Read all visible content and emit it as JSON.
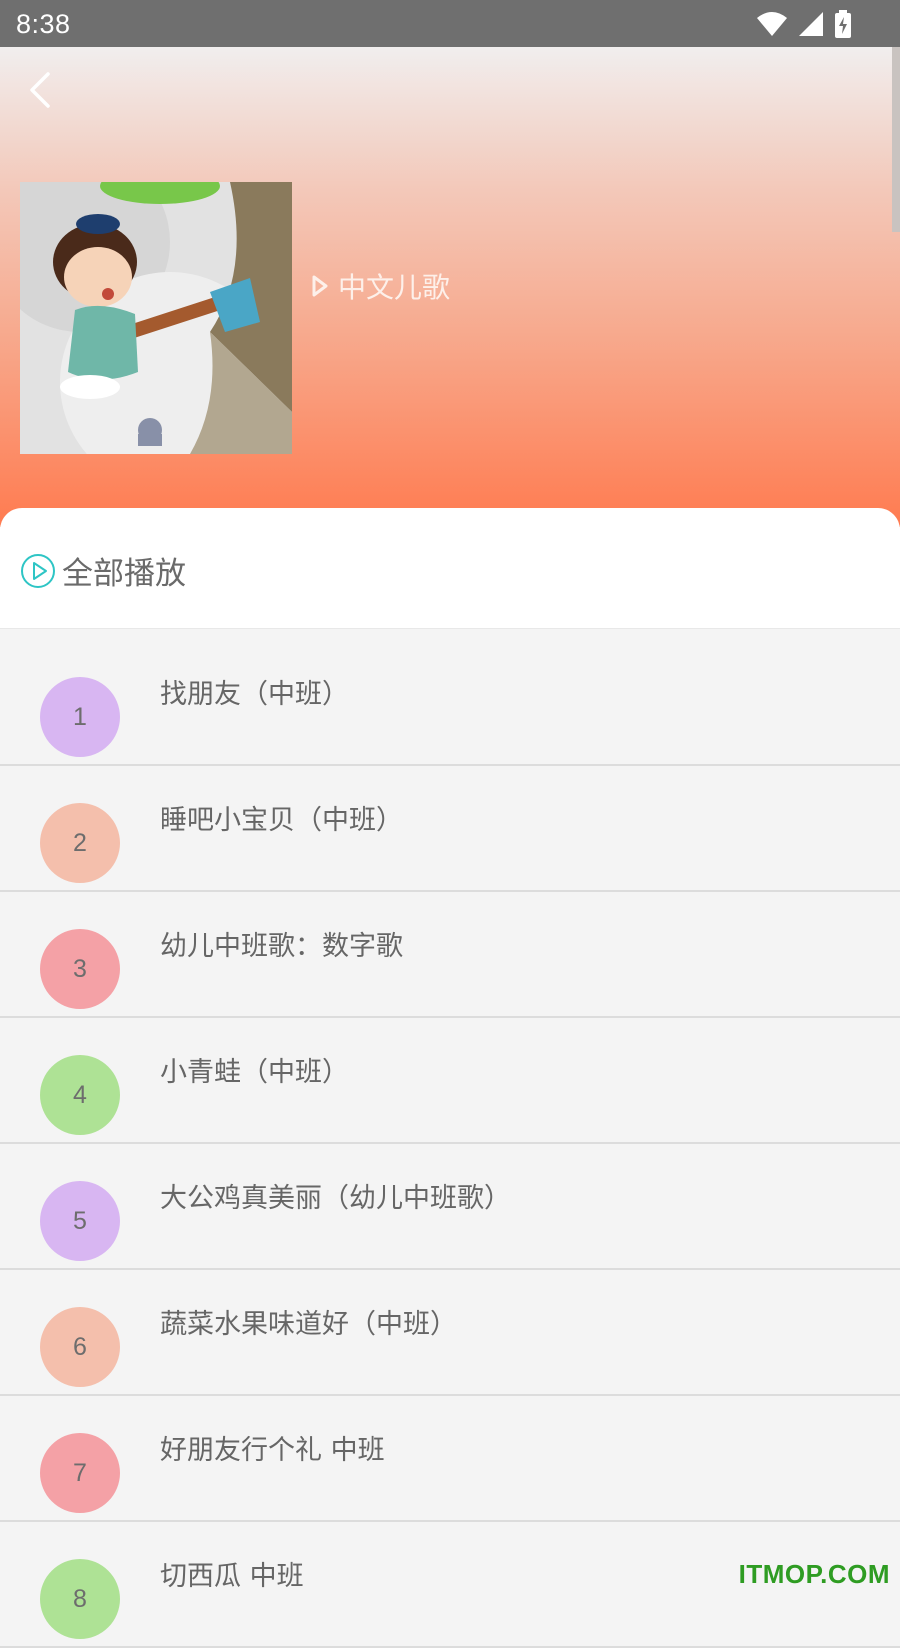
{
  "status_bar": {
    "time": "8:38"
  },
  "album": {
    "category": "中文儿歌"
  },
  "play_all": {
    "label": "全部播放"
  },
  "songs": [
    {
      "index": "1",
      "title": "找朋友（中班）",
      "color": "#d8b6f2"
    },
    {
      "index": "2",
      "title": "睡吧小宝贝（中班）",
      "color": "#f4bfac"
    },
    {
      "index": "3",
      "title": "幼儿中班歌：数字歌",
      "color": "#f4a1a6"
    },
    {
      "index": "4",
      "title": "小青蛙（中班）",
      "color": "#aee295"
    },
    {
      "index": "5",
      "title": "大公鸡真美丽（幼儿中班歌）",
      "color": "#d8b6f2"
    },
    {
      "index": "6",
      "title": "蔬菜水果味道好（中班）",
      "color": "#f4bfac"
    },
    {
      "index": "7",
      "title": "好朋友行个礼 中班",
      "color": "#f4a1a6"
    },
    {
      "index": "8",
      "title": "切西瓜 中班",
      "color": "#aee295"
    }
  ],
  "watermark": "ITMOP.COM",
  "colors": {
    "accent": "#2ec5c5",
    "header_bottom": "#ff7b50"
  }
}
